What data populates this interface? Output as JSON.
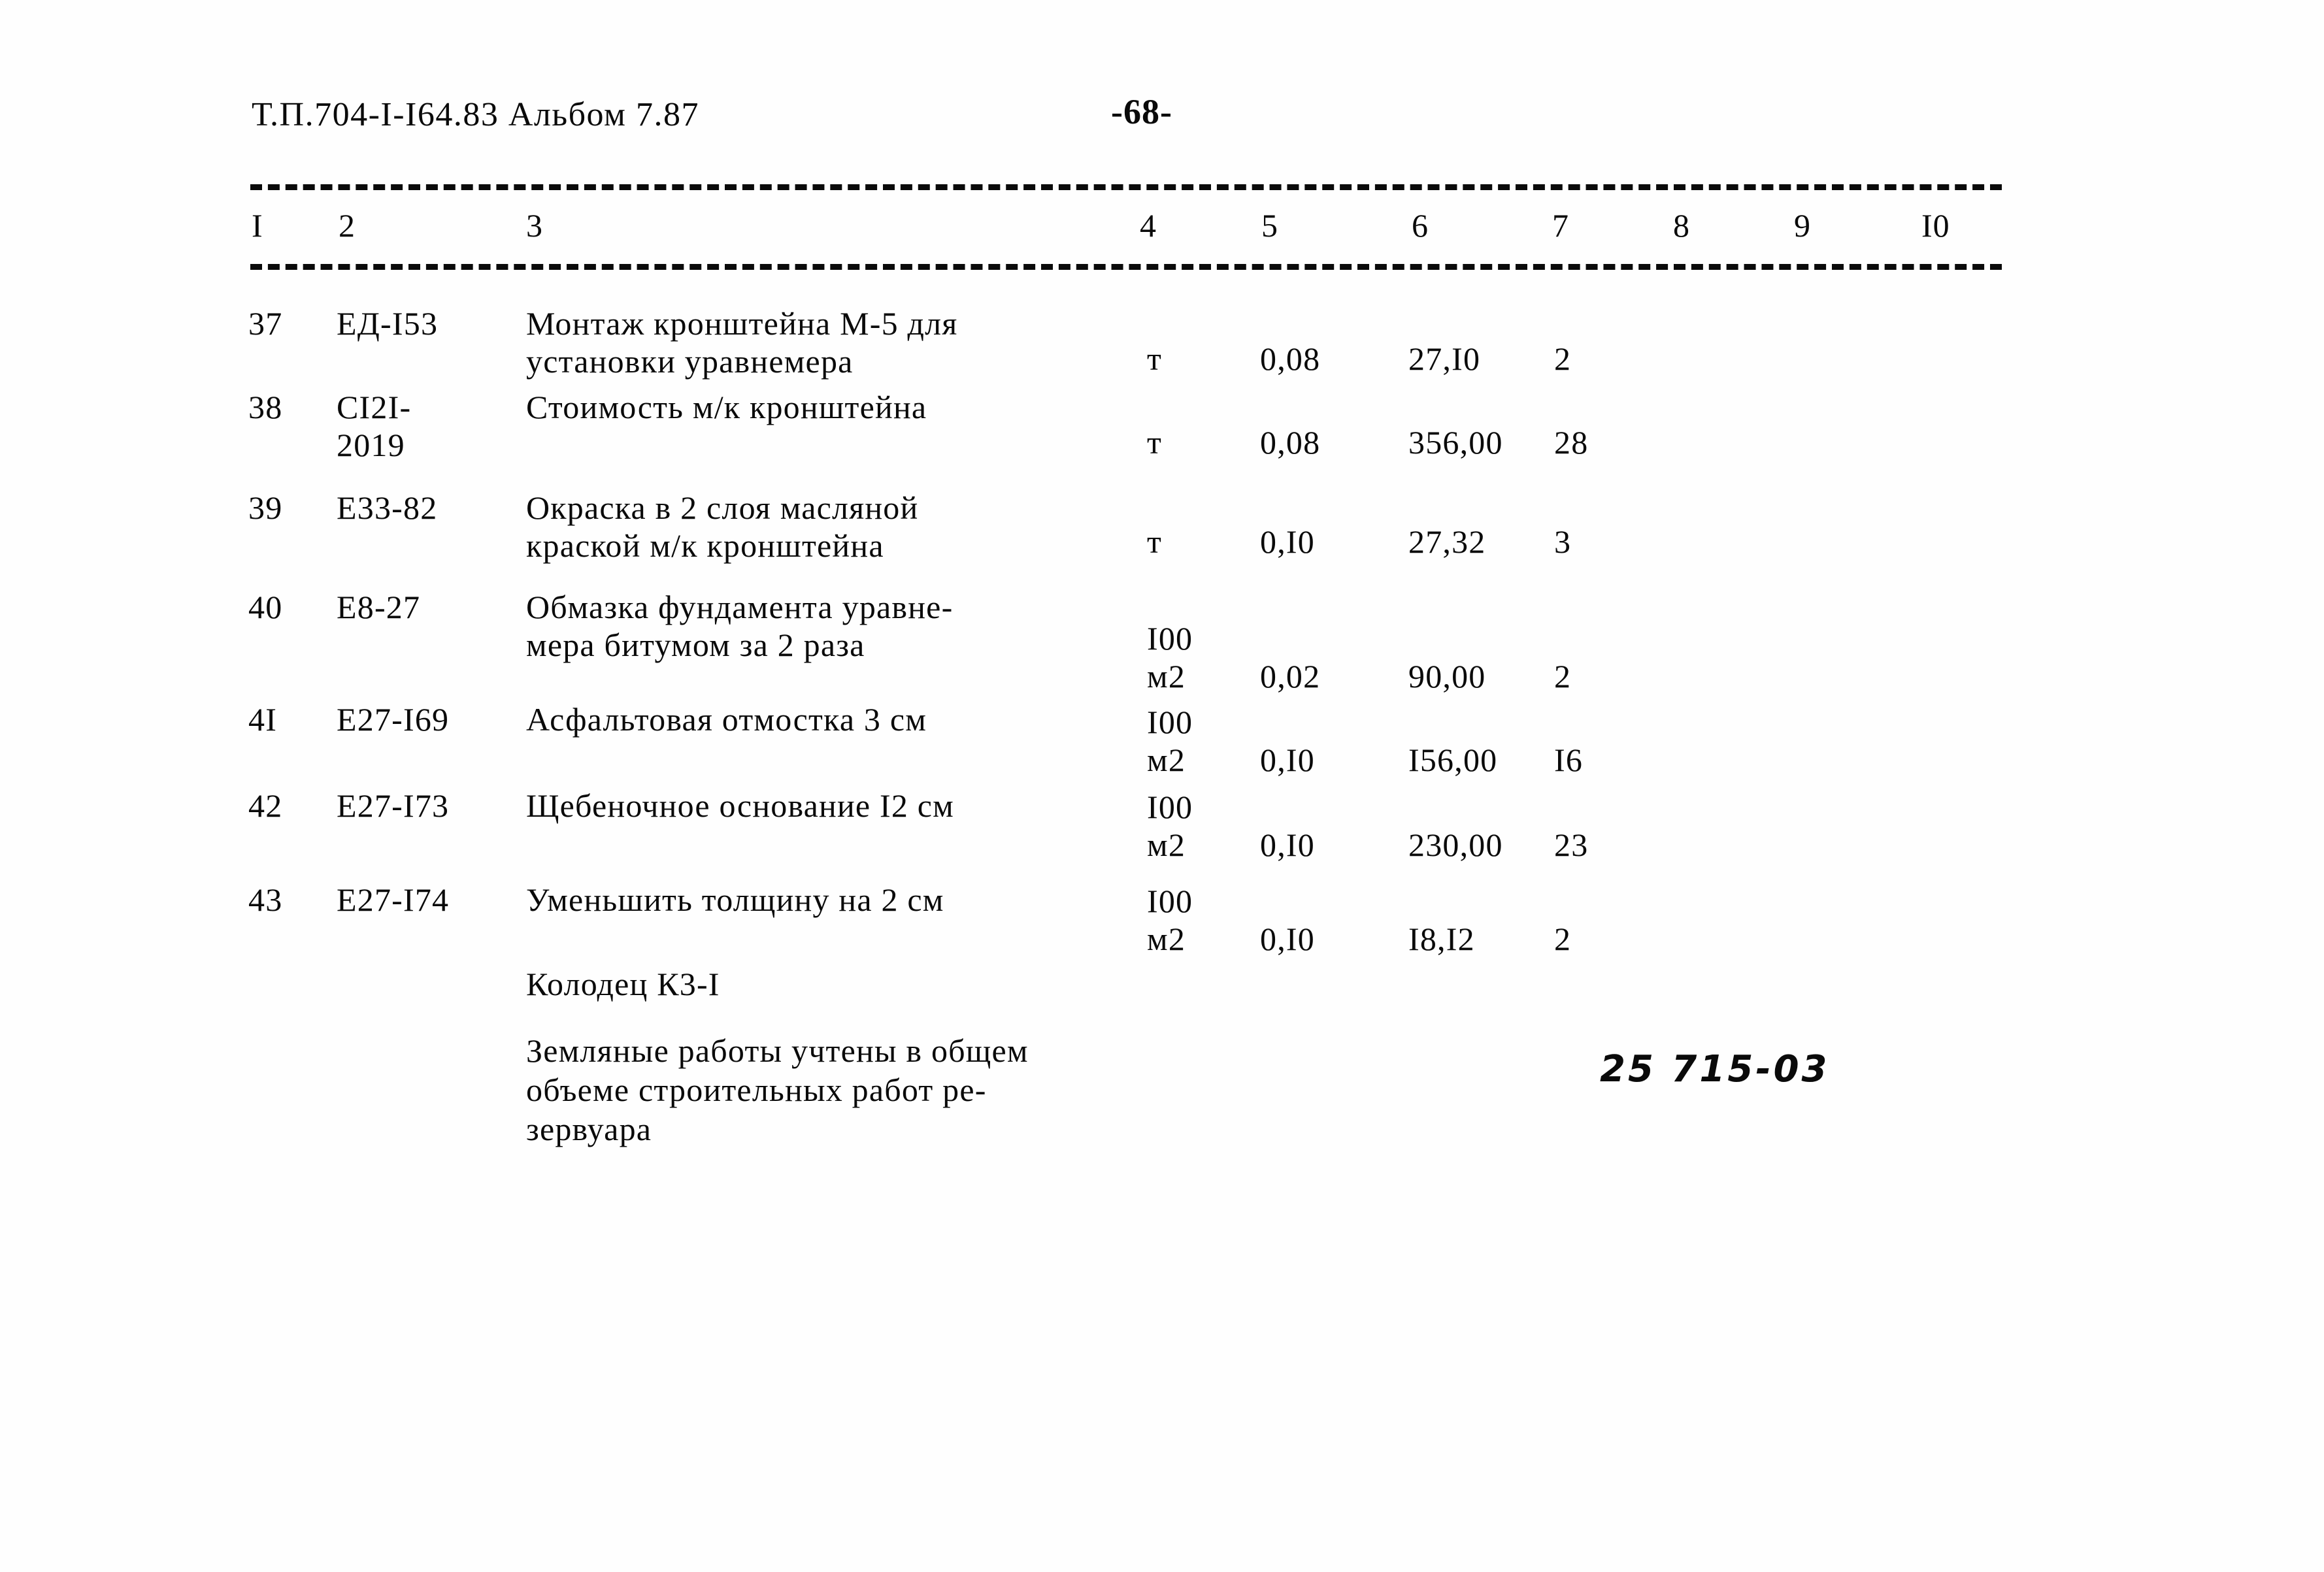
{
  "document": {
    "header_left": "Т.П.704-I-I64.83 Альбом 7.87",
    "page_number": "-68-",
    "hand_written_stamp": "25 715-03"
  },
  "table": {
    "column_headers": [
      "I",
      "2",
      "3",
      "4",
      "5",
      "6",
      "7",
      "8",
      "9",
      "I0"
    ],
    "rows": [
      {
        "num": "37",
        "code": "ЕД-I53",
        "description": "Монтаж кронштейна М-5 для\nустановки уравнемера",
        "unit": "т",
        "qty": "0,08",
        "price": "27,I0",
        "total": "2"
      },
      {
        "num": "38",
        "code": "СI2I-\n2019",
        "description": "Стоимость м/к кронштейна",
        "unit": "т",
        "qty": "0,08",
        "price": "356,00",
        "total": "28"
      },
      {
        "num": "39",
        "code": "Е33-82",
        "description": "Окраска в 2 слоя масляной\nкраской м/к кронштейна",
        "unit": "т",
        "qty": "0,I0",
        "price": "27,32",
        "total": "3"
      },
      {
        "num": "40",
        "code": "Е8-27",
        "description": "Обмазка фундамента уравне-\nмера битумом за 2 раза",
        "unit": "I00\nм2",
        "qty": "0,02",
        "price": "90,00",
        "total": "2"
      },
      {
        "num": "4I",
        "code": "Е27-I69",
        "description": "Асфальтовая отмостка 3 см",
        "unit": "I00\nм2",
        "qty": "0,I0",
        "price": "I56,00",
        "total": "I6"
      },
      {
        "num": "42",
        "code": "Е27-I73",
        "description": "Щебеночное основание I2 см",
        "unit": "I00\nм2",
        "qty": "0,I0",
        "price": "230,00",
        "total": "23"
      },
      {
        "num": "43",
        "code": "Е27-I74",
        "description": "Уменьшить толщину на 2 см",
        "unit": "I00\nм2",
        "qty": "0,I0",
        "price": "I8,I2",
        "total": "2"
      }
    ]
  },
  "notes": {
    "section_title": "Колодец К3-I",
    "body": "Земляные работы учтены в общем\nобъеме строительных работ ре-\nзервуара"
  }
}
